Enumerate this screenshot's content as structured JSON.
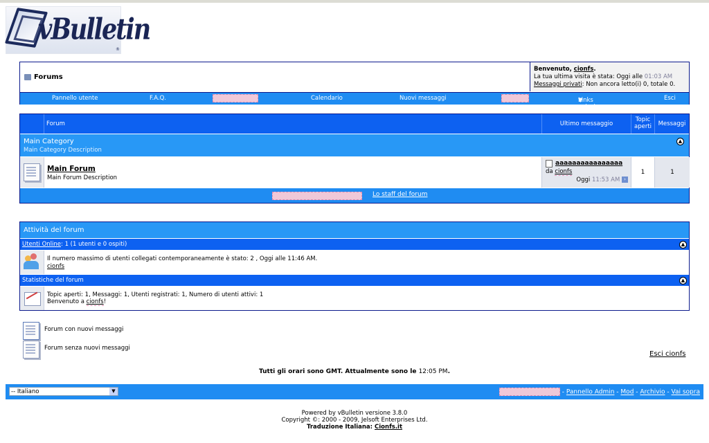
{
  "logo": {
    "word": "vBulletin",
    "reg": "®"
  },
  "header": {
    "title": "Forums",
    "welcome_prefix": "Benvenuto, ",
    "username": "cionfs",
    "welcome_suffix": ".",
    "last_visit": "La tua ultima visita è stata: Oggi alle ",
    "last_visit_time": "01:03 AM",
    "pm_link": "Messaggi privati",
    "pm_text": ": Non ancora letto(i) 0, totale 0."
  },
  "navbar": {
    "user_cp": "Pannello utente",
    "faq": "F.A.Q.",
    "calendar": "Calendario",
    "new_posts": "Nuovi messaggi",
    "quick_links": "Links veloci"
  },
  "forum_table": {
    "col_forum": "Forum",
    "col_last": "Ultimo messaggio",
    "col_topics_1": "Topic",
    "col_topics_2": "aperti",
    "col_posts": "Messaggi",
    "category": {
      "name": "Main Category",
      "description": "Main Category Description"
    },
    "forum": {
      "name": "Main Forum",
      "description": "Main Forum Description",
      "last_title": "aaaaaaaaaaaaaaaa",
      "last_by_prefix": "da ",
      "last_by": "cionfs",
      "last_date": "Oggi",
      "last_time": "11:53 AM",
      "topics": "1",
      "posts": "1"
    },
    "staff_link": "Lo staff del forum"
  },
  "activity": {
    "title": "Attività del forum",
    "online_link": "Utenti Online",
    "online_text": ": 1 (1 utenti e 0 ospiti)",
    "max_users": "Il numero massimo di utenti collegati contemporaneamente è stato: 2 , Oggi alle 11:46 AM.",
    "online_user": "cionfs",
    "stats_title": "Statistiche del forum",
    "stats_text": "Topic aperti: 1, Messaggi: 1, Utenti registrati: 1, Numero di utenti attivi: 1",
    "welcome_prefix": "Benvenuto a ",
    "welcome_user": "cionfs",
    "welcome_suffix": "!"
  },
  "legend": {
    "new_posts": "Forum con nuovi messaggi",
    "no_new_posts": "Forum senza nuovi messaggi"
  },
  "logout_link": "Esci cionfs",
  "time_notice": {
    "prefix": "Tutti gli orari sono GMT. Attualmente sono le ",
    "time": "12:05 PM",
    "suffix": "."
  },
  "footer": {
    "language": "-- Italiano",
    "admin": "Pannello Admin",
    "mod": "Mod",
    "archive": "Archivio",
    "top": "Vai sopra",
    "powered": "Powered by vBulletin versione 3.8.0",
    "copyright": "Copyright ©: 2000 - 2009, Jelsoft Enterprises Ltd.",
    "translation_prefix": "Traduzione Italiana: ",
    "translation_link": "Cionfs.it"
  },
  "colors": {
    "nav_blue": "#1f8cf2",
    "header_blue": "#0d61f1",
    "border": "#0b198c"
  }
}
